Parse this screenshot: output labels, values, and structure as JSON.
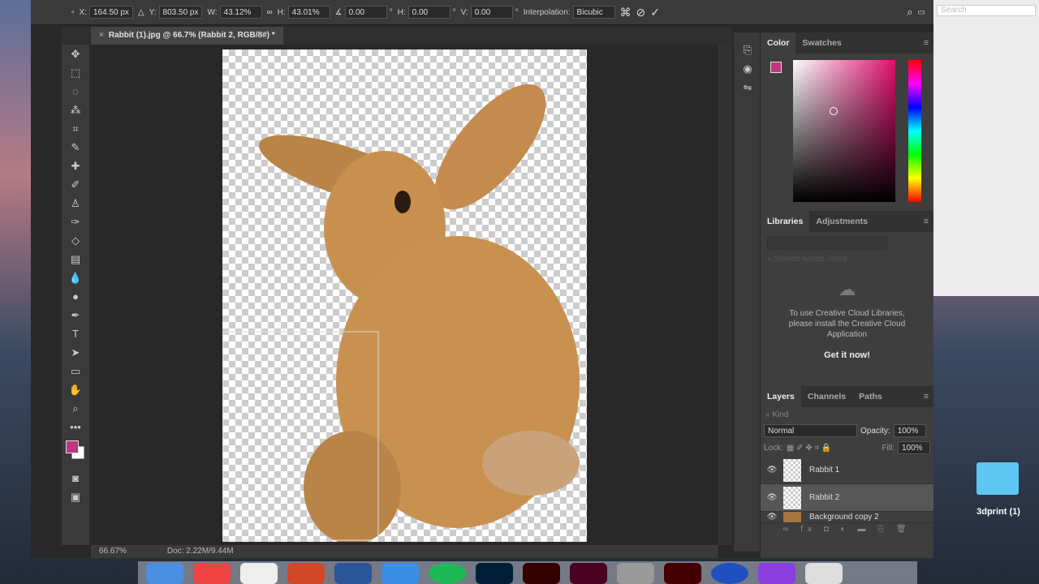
{
  "options": {
    "x_label": "X:",
    "x": "164.50 px",
    "y_label": "Y:",
    "y": "803.50 px",
    "w_label": "W:",
    "w": "43.12%",
    "h_label": "H:",
    "h": "43.01%",
    "angle": "0.00",
    "hskew_label": "H:",
    "hskew": "0.00",
    "vskew_label": "V:",
    "vskew": "0.00",
    "interp_label": "Interpolation:",
    "interp": "Bicubic"
  },
  "document": {
    "tab_title": "Rabbit (1).jpg @ 66.7% (Rabbit 2, RGB/8#) *",
    "zoom": "66.67%",
    "doc_size": "Doc: 2.22M/9.44M"
  },
  "color_panel": {
    "tabs": [
      "Color",
      "Swatches"
    ],
    "foreground": "#c0357e",
    "background": "#ffffff"
  },
  "libraries_panel": {
    "tabs": [
      "Libraries",
      "Adjustments"
    ],
    "search_placeholder": "Search Adobe Stock",
    "message": "To use Creative Cloud Libraries, please install the Creative Cloud Application",
    "cta": "Get it now!"
  },
  "layers_panel": {
    "tabs": [
      "Layers",
      "Channels",
      "Paths"
    ],
    "filter_placeholder": "Kind",
    "blend_mode": "Normal",
    "opacity_label": "Opacity:",
    "opacity": "100%",
    "lock_label": "Lock:",
    "fill_label": "Fill:",
    "fill": "100%",
    "layers": [
      {
        "name": "Rabbit 1",
        "selected": false
      },
      {
        "name": "Rabbit 2",
        "selected": true
      },
      {
        "name": "Background copy 2",
        "selected": false
      }
    ]
  },
  "desktop": {
    "folder_label": "3dprint (1)",
    "browser_search": "Search"
  }
}
